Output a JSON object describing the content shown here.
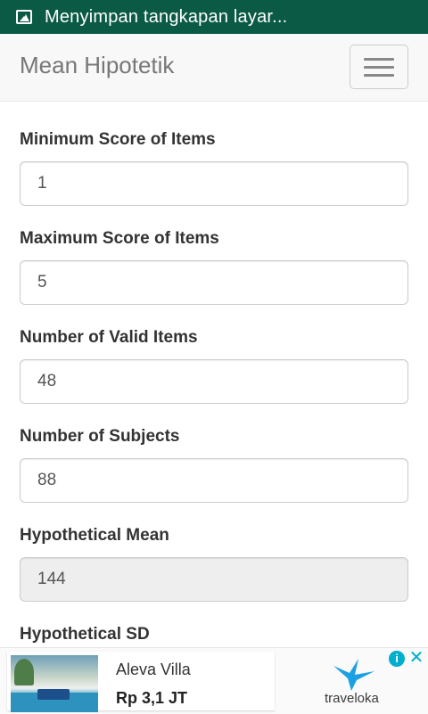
{
  "status_bar": {
    "text": "Menyimpan tangkapan layar...",
    "icon": "image-icon"
  },
  "navbar": {
    "brand": "Mean Hipotetik",
    "toggle_icon": "hamburger-menu-icon"
  },
  "form": {
    "fields": [
      {
        "label": "Minimum Score of Items",
        "value": "1",
        "readonly": false
      },
      {
        "label": "Maximum Score of Items",
        "value": "5",
        "readonly": false
      },
      {
        "label": "Number of Valid Items",
        "value": "48",
        "readonly": false
      },
      {
        "label": "Number of Subjects",
        "value": "88",
        "readonly": false
      },
      {
        "label": "Hypothetical Mean",
        "value": "144",
        "readonly": true
      },
      {
        "label": "Hypothetical SD",
        "value": "",
        "readonly": true
      }
    ]
  },
  "ad": {
    "title": "Aleva Villa",
    "price": "Rp 3,1 JT",
    "brand": "traveloka",
    "info_icon": "info-icon",
    "close_icon": "close-icon",
    "accent": "#00aecd"
  },
  "colors": {
    "status_bar": "#0b5a45",
    "navbar_bg": "#f8f8f8"
  }
}
